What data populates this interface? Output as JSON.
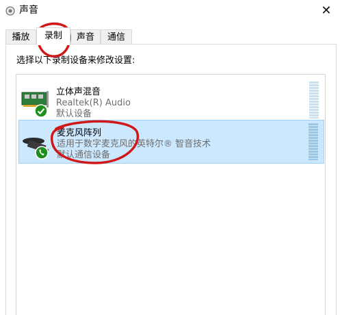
{
  "window": {
    "title": "声音",
    "close_glyph": "✕"
  },
  "tabs": [
    {
      "label": "播放",
      "active": false
    },
    {
      "label": "录制",
      "active": true
    },
    {
      "label": "声音",
      "active": false
    },
    {
      "label": "通信",
      "active": false
    }
  ],
  "instruction": "选择以下录制设备来修改设置:",
  "devices": [
    {
      "name": "立体声混音",
      "description": "Realtek(R) Audio",
      "status": "默认设备",
      "icon": "sound-card-icon",
      "badge": "check-badge-icon",
      "selected": false
    },
    {
      "name": "麦克风阵列",
      "description": "适用于数字麦克风的英特尔® 智音技术",
      "status": "默认通信设备",
      "icon": "microphone-icon",
      "badge": "phone-badge-icon",
      "selected": true
    }
  ],
  "colors": {
    "selection_bg": "#cce8ff",
    "selection_border": "#99d1ff",
    "annotation": "#d01818",
    "badge_green": "#1e8f1e"
  }
}
